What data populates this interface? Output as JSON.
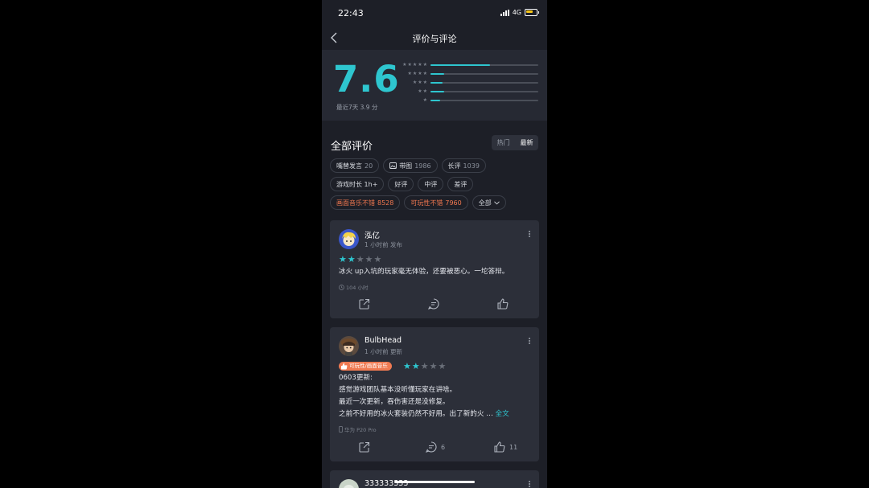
{
  "status": {
    "time": "22:43",
    "network": "4G"
  },
  "nav": {
    "title": "评价与评论"
  },
  "rating": {
    "score": "7.6",
    "recent": "最近7天 3.9 分",
    "distribution": [
      {
        "stars": "★★★★★",
        "fraction": 0.55
      },
      {
        "stars": "★★★★",
        "fraction": 0.13
      },
      {
        "stars": "★★★",
        "fraction": 0.11
      },
      {
        "stars": "★★",
        "fraction": 0.13
      },
      {
        "stars": "★",
        "fraction": 0.09
      }
    ]
  },
  "section": {
    "title": "全部评价",
    "sort": {
      "hot": "热门",
      "latest": "最新",
      "selected": "最新"
    }
  },
  "tags": {
    "row1": [
      {
        "label": "嘴替发言",
        "count": "20"
      },
      {
        "label": "带图",
        "count": "1986"
      },
      {
        "label": "长评",
        "count": "1039"
      }
    ],
    "row2": [
      "游戏时长 1h+",
      "好评",
      "中评",
      "差评"
    ],
    "row3": [
      {
        "label": "画面音乐不错",
        "count": "8528"
      },
      {
        "label": "可玩性不错",
        "count": "7960"
      }
    ],
    "all": "全部"
  },
  "reviews": [
    {
      "user": "泓亿",
      "time": "1 小时前 发布",
      "rating": 2,
      "text": "冰火 up入坑的玩家毫无体验，还要被恶心。一坨答辩。",
      "meta": "104 小时",
      "comments": "",
      "likes": ""
    },
    {
      "user": "BulbHead",
      "time": "1 小时前 更新",
      "badge": "可玩性/画面音乐",
      "rating": 2,
      "lines": [
        "0603更新:",
        "感觉游戏团队基本没听懂玩家在讲啥。",
        "最近一次更新，吞伤害还是没修复。",
        "之前不好用的冰火套装仍然不好用。出了新的火 …"
      ],
      "full": "全文",
      "meta": "华为 P20 Pro",
      "comments": "6",
      "likes": "11"
    },
    {
      "user": "333333333"
    }
  ],
  "colors": {
    "accent": "#2ec6cf",
    "hot": "#f0774f",
    "bg": "#1d1f27",
    "card": "#2c2f39"
  }
}
